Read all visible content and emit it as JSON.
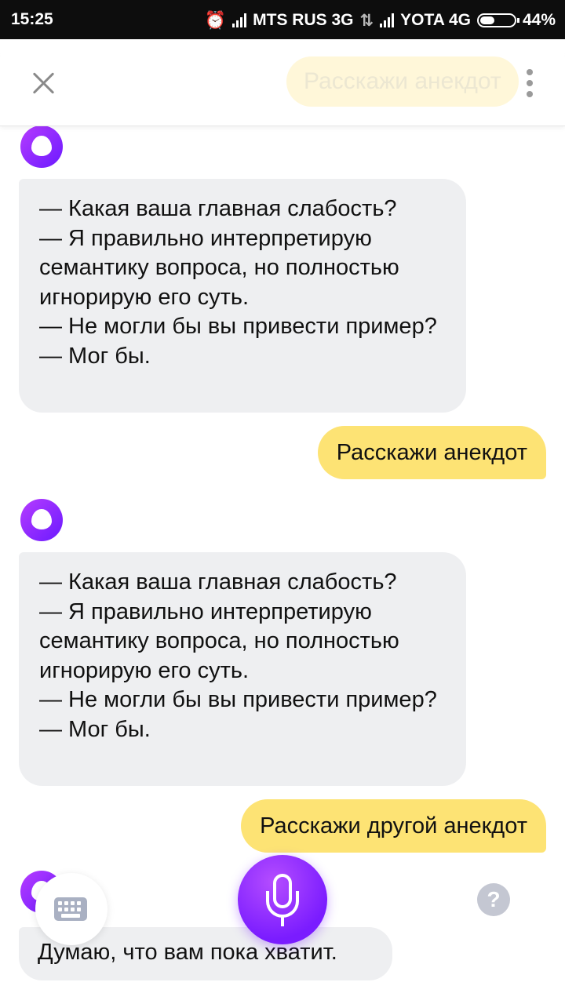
{
  "status": {
    "time": "15:25",
    "carrier1": "MTS RUS 3G",
    "carrier2": "YOTA 4G",
    "battery": "44%",
    "battery_level": 0.44
  },
  "header": {
    "suggest": "Расскажи анекдот"
  },
  "messages": [
    {
      "from": "alice",
      "text": "— Какая ваша главная слабость?\n— Я правильно интерпретирую семантику вопроса, но полностью игнорирую его суть.\n— Не могли бы вы привести пример?\n— Мог бы."
    },
    {
      "from": "user",
      "text": "Расскажи анекдот"
    },
    {
      "from": "alice",
      "text": "— Какая ваша главная слабость?\n— Я правильно интерпретирую семантику вопроса, но полностью игнорирую его суть.\n— Не могли бы вы привести пример?\n— Мог бы."
    },
    {
      "from": "user",
      "text": "Расскажи другой анекдот"
    },
    {
      "from": "alice",
      "text": "Думаю, что вам пока хватит."
    }
  ],
  "bottom": {
    "help_label": "?"
  },
  "colors": {
    "user_bubble": "#fde374",
    "alice_bubble": "#eeeff1",
    "accent": "#8a2cff"
  }
}
